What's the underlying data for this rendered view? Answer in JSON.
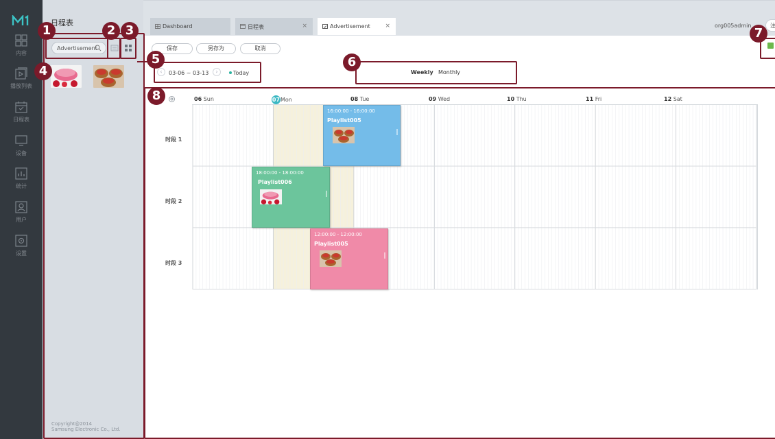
{
  "nav": {
    "items": [
      {
        "name": "content",
        "label": "内容",
        "icon": "grid-icon"
      },
      {
        "name": "playlist",
        "label": "播放列表",
        "icon": "playlist-icon"
      },
      {
        "name": "schedule",
        "label": "日程表",
        "icon": "calendar-icon"
      },
      {
        "name": "device",
        "label": "设备",
        "icon": "monitor-icon"
      },
      {
        "name": "statistics",
        "label": "统计",
        "icon": "chart-icon"
      },
      {
        "name": "user",
        "label": "用户",
        "icon": "user-icon"
      },
      {
        "name": "settings",
        "label": "设置",
        "icon": "settings-icon"
      }
    ]
  },
  "side": {
    "title": "日程表",
    "search_value": "Advertisement",
    "copyright_line1": "Copyright@2014",
    "copyright_line2": "Samsung Electronic Co., Ltd."
  },
  "tabs": [
    {
      "label": "Dashboard",
      "icon": "dashboard-icon",
      "closable": false
    },
    {
      "label": "日程表",
      "icon": "calendar-icon",
      "closable": true
    },
    {
      "label": "Advertisement",
      "icon": "calendar-check-icon",
      "closable": true,
      "active": true
    }
  ],
  "header": {
    "username": "org005admin",
    "logout_label": "注销"
  },
  "toolbar": {
    "save_label": "保存",
    "save_as_label": "另存为",
    "cancel_label": "取消"
  },
  "date_nav": {
    "range": "03-06 ~ 03-13",
    "today_label": "Today"
  },
  "view_switch": {
    "weekly_label": "Weekly",
    "monthly_label": "Monthly",
    "selected": "Weekly"
  },
  "calendar": {
    "days": [
      {
        "num": "06",
        "name": "Sun"
      },
      {
        "num": "07",
        "name": "Mon",
        "today": true
      },
      {
        "num": "08",
        "name": "Tue"
      },
      {
        "num": "09",
        "name": "Wed"
      },
      {
        "num": "10",
        "name": "Thu"
      },
      {
        "num": "11",
        "name": "Fri"
      },
      {
        "num": "12",
        "name": "Sat"
      }
    ],
    "slots": [
      "时段 1",
      "时段 2",
      "时段 3"
    ],
    "events": [
      {
        "time": "16:00:00 - 16:00:00",
        "name": "Playlist005",
        "color": "#74bce9"
      },
      {
        "time": "18:00:00 - 18:00:00",
        "name": "Playlist006",
        "color": "#6cc59c"
      },
      {
        "time": "12:00:00 - 12:00:00",
        "name": "Playlist005",
        "color": "#f08aa8"
      }
    ]
  },
  "annotations": [
    "1",
    "2",
    "3",
    "4",
    "5",
    "6",
    "7",
    "8"
  ],
  "colors": {
    "annotation": "#7b1a2a",
    "nav_bg": "#33393f",
    "today_badge": "#3bb8c3"
  }
}
